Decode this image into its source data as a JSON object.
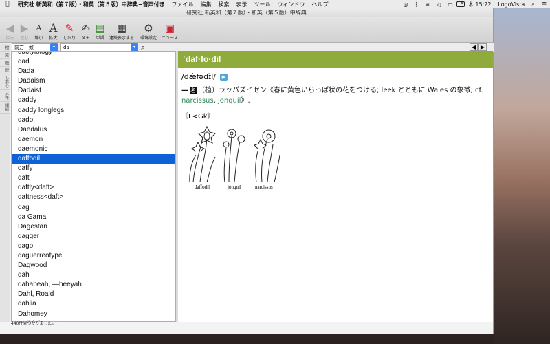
{
  "menubar": {
    "app": "研究社 新英和（第７版）・和英（第５版）中辞典−音声付き",
    "items": [
      "ファイル",
      "編集",
      "検索",
      "表示",
      "ツール",
      "ウィンドウ",
      "ヘルプ"
    ],
    "input_indicator": "A",
    "datetime": "木 15:22",
    "vendor": "LogoVista"
  },
  "window": {
    "title": "研究社 新英和（第７版）・和英（第５版）中辞典",
    "toolbar": [
      {
        "label": "戻る",
        "icon": "back-arrow-icon",
        "glyph": "◀",
        "disabled": true
      },
      {
        "label": "進む",
        "icon": "forward-arrow-icon",
        "glyph": "▶",
        "disabled": true
      },
      {
        "label": "縮小",
        "icon": "font-smaller-icon",
        "glyph": "A",
        "disabled": false
      },
      {
        "label": "拡大",
        "icon": "font-larger-icon",
        "glyph": "A",
        "disabled": false
      },
      {
        "label": "しおり",
        "icon": "bookmark-icon",
        "glyph": "✎",
        "disabled": false
      },
      {
        "label": "メモ",
        "icon": "memo-icon",
        "glyph": "✍",
        "disabled": false
      },
      {
        "label": "単語",
        "icon": "word-icon",
        "glyph": "▤",
        "disabled": false
      },
      {
        "label": "連続表示する",
        "icon": "continuous-display-icon",
        "glyph": "▦",
        "disabled": false
      },
      {
        "label": "環境設定",
        "icon": "settings-gear-icon",
        "glyph": "⚙",
        "disabled": false
      },
      {
        "label": "ニュース",
        "icon": "news-icon",
        "glyph": "▣",
        "disabled": false
      }
    ]
  },
  "search": {
    "mode": "前方一致",
    "query": "da"
  },
  "side_tabs": [
    "検",
    "索",
    "履",
    "歴",
    "しおり",
    "メモ",
    "単語"
  ],
  "words": [
    "dactylology",
    "dad",
    "Dada",
    "Dadaism",
    "Dadaist",
    "daddy",
    "daddy longlegs",
    "dado",
    "Daedalus",
    "daemon",
    "daemonic",
    "daffodil",
    "daffy",
    "daft",
    "daftly<daft>",
    "daftness<daft>",
    "dag",
    "da Gama",
    "Dagestan",
    "dagger",
    "dago",
    "daguerreotype",
    "Dagwood",
    "dah",
    "dahabeah, —beeyah",
    "Dahl, Roald",
    "dahlia",
    "Dahomey",
    "Dail (Eireann)"
  ],
  "selected_word": "daffodil",
  "entry": {
    "headword": "ˈdaf·fo·dil",
    "pronunciation": "/dǽfədɪ̀l/",
    "def_prefix": "—",
    "pos": "名",
    "def_text": "（植）ラッパズイセン《春に黄色いらっぱ状の花をつける; leek とともに Wales の象徴; cf. ",
    "link1": "narcissus",
    "sep": ", ",
    "link2": "jonquil",
    "def_end": "》.",
    "etymology": "〘L<Gk〙",
    "caption1": "daffodil",
    "caption2": "jonquil",
    "caption3": "narcissus"
  },
  "status": "440件見つかりました。"
}
